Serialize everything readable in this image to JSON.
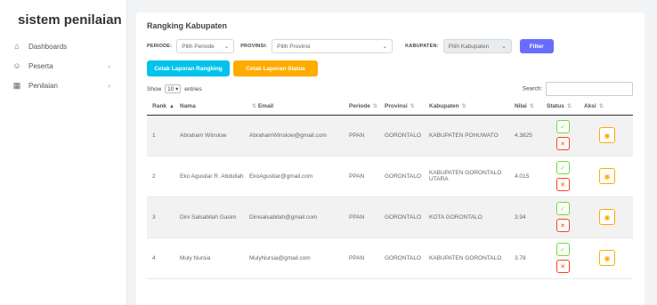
{
  "app": {
    "brand": "sistem penilaian"
  },
  "sidebar": {
    "items": [
      {
        "label": "Dashboards",
        "icon": "home-icon",
        "glyph": "⌂",
        "chevron": ""
      },
      {
        "label": "Peserta",
        "icon": "user-icon",
        "glyph": "☺",
        "chevron": "›"
      },
      {
        "label": "Penilaian",
        "icon": "table-icon",
        "glyph": "▦",
        "chevron": "›"
      }
    ]
  },
  "page": {
    "title": "Rangking Kabupaten"
  },
  "filters": {
    "periode_label": "PERIODE:",
    "periode_value": "Pilih Periode",
    "provinsi_label": "PROVINSI:",
    "provinsi_value": "Pilih Provinsi",
    "kabupaten_label": "KABUPATEN:",
    "kabupaten_value": "Pilih Kabupaten",
    "filter_button": "Filter"
  },
  "actions": {
    "cetak_rangking": "Cetak Laporan Rangking",
    "cetak_status": "Cetak Laporan Status"
  },
  "table_controls": {
    "show_label": "Show",
    "entries_value": "10",
    "entries_label": "entries",
    "search_label": "Search:"
  },
  "table": {
    "headers": [
      "Rank",
      "Nama",
      "Email",
      "Periode",
      "Provinsi",
      "Kabupaten",
      "Nilai",
      "Status",
      "Aksi"
    ],
    "rows": [
      {
        "rank": "1",
        "nama": "Abraham Winslow",
        "email": "AbrahamWinslow@gmail.com",
        "periode": "PPAN",
        "provinsi": "GORONTALO",
        "kabupaten": "KABUPATEN POHUWATO",
        "nilai": "4.3825"
      },
      {
        "rank": "2",
        "nama": "Eko Agustiar R. Abdullah",
        "email": "EkoAgustiar@gmail.com",
        "periode": "PPAN",
        "provinsi": "GORONTALO",
        "kabupaten": "KABUPATEN GORONTALO UTARA",
        "nilai": "4.015"
      },
      {
        "rank": "3",
        "nama": "Dini Salsabilah Gasim",
        "email": "Dinisalsabilah@gmail.com",
        "periode": "PPAN",
        "provinsi": "GORONTALO",
        "kabupaten": "KOTA GORONTALO",
        "nilai": "3.94"
      },
      {
        "rank": "4",
        "nama": "Muly Nursia",
        "email": "MulyNursia@gmail.com",
        "periode": "PPAN",
        "provinsi": "GORONTALO",
        "kabupaten": "KABUPATEN GORONTALO",
        "nilai": "3.78"
      }
    ]
  },
  "colors": {
    "primary": "#696cff",
    "cyan": "#03c3ec",
    "orange": "#ffab00",
    "success": "#71dd37",
    "danger": "#ff3e1d"
  }
}
